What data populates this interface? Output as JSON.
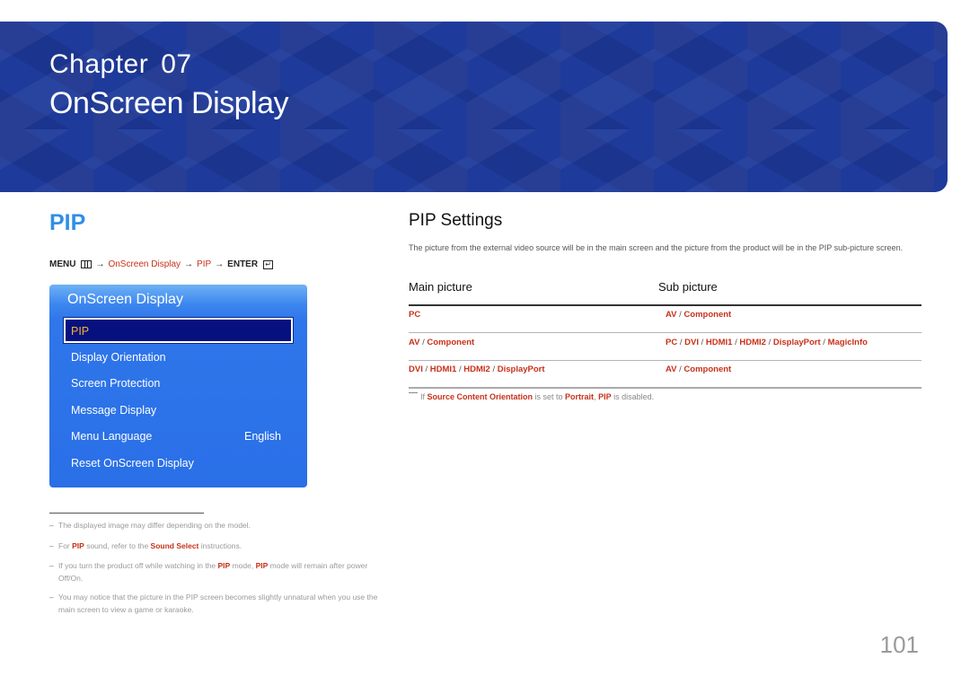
{
  "banner": {
    "chapter_label": "Chapter",
    "chapter_number": "07",
    "title": "OnScreen Display",
    "color": "#1e3a9a"
  },
  "left": {
    "heading": "PIP",
    "menu_path": {
      "menu": "MENU",
      "menu_icon": "menu-icon",
      "arrow": "→",
      "step1": "OnScreen Display",
      "step2": "PIP",
      "enter": "ENTER",
      "enter_icon": "enter-icon"
    },
    "osd": {
      "title": "OnScreen Display",
      "items": [
        {
          "label": "PIP",
          "selected": true
        },
        {
          "label": "Display Orientation"
        },
        {
          "label": "Screen Protection"
        },
        {
          "label": "Message Display"
        },
        {
          "label": "Menu Language",
          "value": "English"
        },
        {
          "label": "Reset OnScreen Display"
        }
      ]
    },
    "notes": [
      {
        "text": "The displayed image may differ depending on the model."
      },
      {
        "parts": [
          "For ",
          "PIP",
          " sound, refer to the ",
          "Sound Select",
          " instructions."
        ]
      },
      {
        "parts": [
          "If you turn the product off while watching in the ",
          "PIP",
          " mode, ",
          "PIP",
          " mode will remain after power Off/On."
        ]
      },
      {
        "text": "You may notice that the picture in the PIP screen becomes slightly unnatural when you use the main screen to view a game or karaoke."
      }
    ]
  },
  "right": {
    "heading": "PIP Settings",
    "description": "The picture from the external video source will be in the main screen and the picture from the product will be in the PIP sub-picture screen.",
    "table": {
      "headers": [
        "Main picture",
        "Sub picture"
      ],
      "rows": [
        {
          "main": [
            "PC"
          ],
          "sub": [
            "AV",
            "Component"
          ]
        },
        {
          "main": [
            "AV",
            "Component"
          ],
          "sub": [
            "PC",
            "DVI",
            "HDMI1",
            "HDMI2",
            "DisplayPort",
            "MagicInfo"
          ]
        },
        {
          "main": [
            "DVI",
            "HDMI1",
            "HDMI2",
            "DisplayPort"
          ],
          "sub": [
            "AV",
            "Component"
          ]
        }
      ]
    },
    "note": {
      "parts": [
        "If ",
        "Source Content Orientation",
        " is set to ",
        "Portrait",
        ", ",
        "PIP",
        " is disabled."
      ]
    }
  },
  "page_number": "101",
  "colors": {
    "accent_red": "#c8311a",
    "heading_blue": "#2f8fe8",
    "osd_blue": "#2a6fe7",
    "osd_selected": "#06107f",
    "osd_selected_text": "#f2b233"
  }
}
